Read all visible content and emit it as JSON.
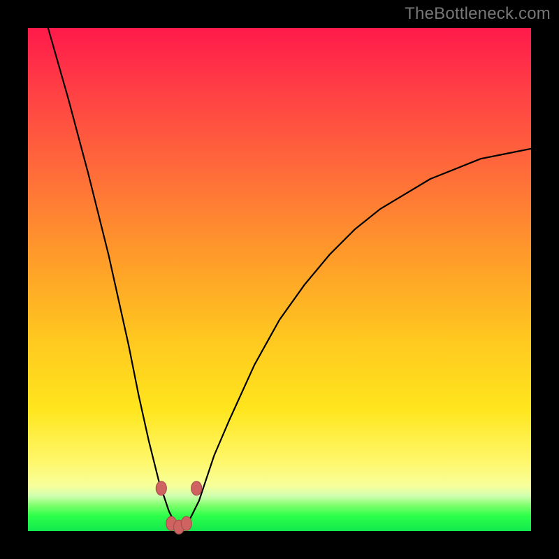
{
  "watermark": "TheBottleneck.com",
  "colors": {
    "background": "#000000",
    "curve": "#000000",
    "marker_fill": "#cf6361",
    "marker_stroke": "#a84f4d",
    "gradient_top": "#ff1a4b",
    "gradient_bottom": "#12e84e"
  },
  "chart_data": {
    "type": "line",
    "title": "",
    "xlabel": "",
    "ylabel": "",
    "xlim": [
      0,
      100
    ],
    "ylim": [
      0,
      100
    ],
    "grid": false,
    "note": "Axes are unlabeled in the source image; x and y are generic 0–100 scales. The curve is a narrow V-shaped dip reaching y≈0 near x≈30, rising steeply toward y≈100 on the left edge and asymptotically toward y≈75 on the right edge.",
    "series": [
      {
        "name": "bottleneck-curve",
        "x": [
          4,
          8,
          12,
          16,
          20,
          22,
          24,
          26,
          27,
          28,
          29,
          30,
          31,
          32,
          33,
          34,
          35,
          37,
          40,
          45,
          50,
          55,
          60,
          65,
          70,
          75,
          80,
          85,
          90,
          95,
          100
        ],
        "y": [
          100,
          86,
          71,
          55,
          37,
          27,
          18,
          10,
          7,
          4,
          2,
          1,
          1,
          2,
          4,
          6,
          9,
          15,
          22,
          33,
          42,
          49,
          55,
          60,
          64,
          67,
          70,
          72,
          74,
          75,
          76
        ]
      }
    ],
    "markers": {
      "name": "highlight-points",
      "note": "Small reddish/salmon rounded markers clustered around the valley bottom.",
      "points": [
        {
          "x": 26.5,
          "y": 8.5
        },
        {
          "x": 28.5,
          "y": 1.5
        },
        {
          "x": 30.0,
          "y": 0.8
        },
        {
          "x": 31.5,
          "y": 1.5
        },
        {
          "x": 33.5,
          "y": 8.5
        }
      ]
    }
  }
}
